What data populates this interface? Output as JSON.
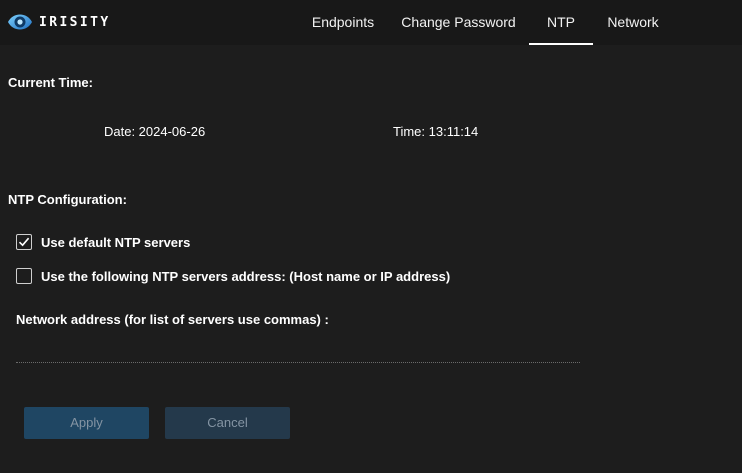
{
  "brand": {
    "name": "IRISITY",
    "logo_icon": "irisity-eye-logo",
    "accent": "#2f8fd6"
  },
  "nav": {
    "tabs": [
      {
        "label": "Endpoints",
        "active": false
      },
      {
        "label": "Change Password",
        "active": false
      },
      {
        "label": "NTP",
        "active": true
      },
      {
        "label": "Network",
        "active": false
      }
    ]
  },
  "current_time": {
    "title": "Current Time:",
    "date": "Date: 2024-06-26",
    "time": "Time: 13:11:14"
  },
  "ntp_config": {
    "title": "NTP Configuration:",
    "use_default": {
      "label": "Use default NTP servers",
      "checked": true
    },
    "use_following": {
      "label": "Use the following NTP servers address: (Host name or IP address)",
      "checked": false
    },
    "address_label": "Network address (for list of servers use commas) :",
    "address_value": ""
  },
  "actions": {
    "apply_label": "Apply",
    "cancel_label": "Cancel",
    "apply_color": "#1f4663",
    "cancel_color": "#24394b"
  }
}
